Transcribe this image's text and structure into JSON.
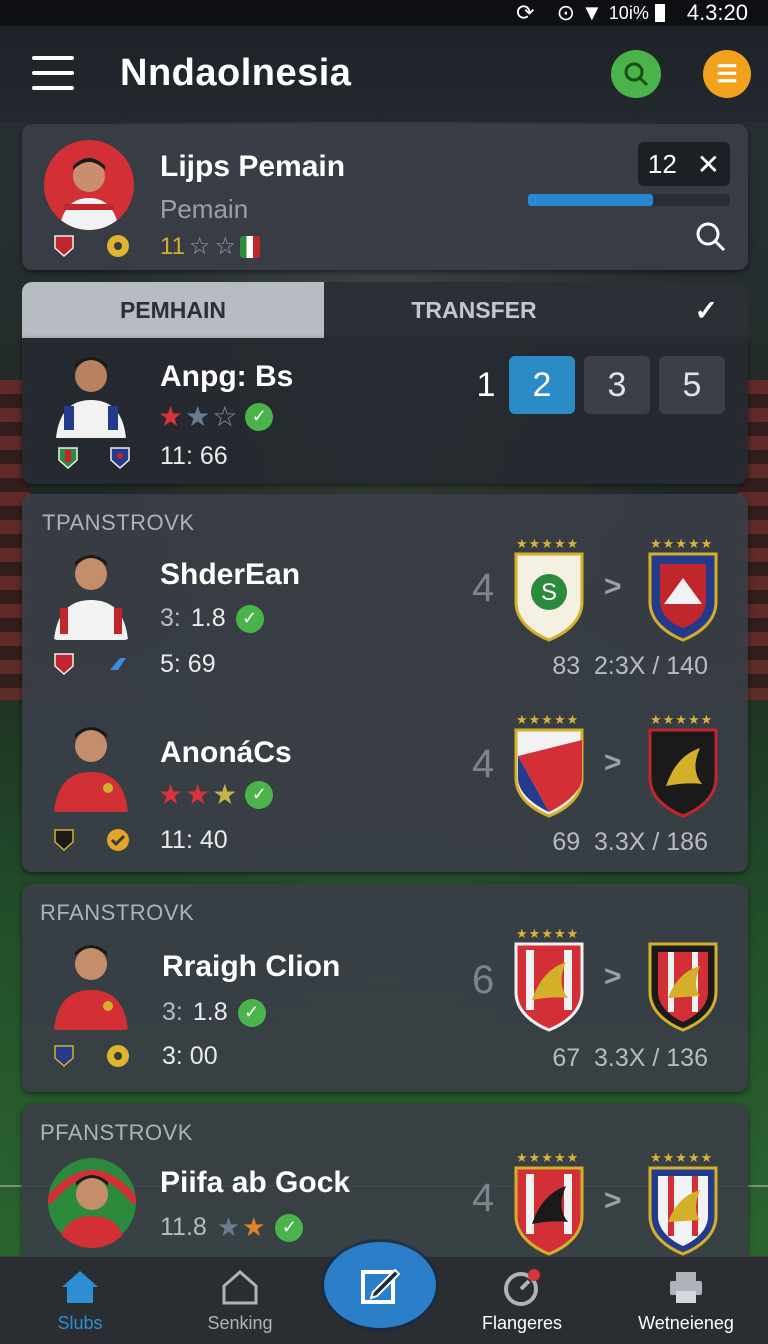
{
  "status_bar": {
    "battery": "10i%",
    "time": "4.3:20"
  },
  "app_bar": {
    "title": "Nndaolnesia"
  },
  "profile": {
    "name": "Lijps Pemain",
    "role": "Pemain",
    "rating": "11",
    "count": "12",
    "progress": 0.62
  },
  "tabs": [
    {
      "label": "PEMHAIN"
    },
    {
      "label": "TRANSFER"
    }
  ],
  "player_row": {
    "name": "Anpg: Bs",
    "time": "11: 66",
    "pages": [
      "1",
      "2",
      "3",
      "5"
    ]
  },
  "sections": [
    {
      "label": "TPANSTROVK",
      "items": [
        {
          "name": "ShderEan",
          "stat_a": "3:",
          "stat_a_val": "1.8",
          "stat_b": "5: 69",
          "count": "4",
          "transfer": "83  2:3X / 140"
        },
        {
          "name": "AnonáCs",
          "stat_b": "11: 40",
          "count": "4",
          "transfer": "69  3.3X / 186"
        }
      ]
    },
    {
      "label": "RFANSTROVK",
      "items": [
        {
          "name": "Rraigh Clion",
          "stat_a": "3:",
          "stat_a_val": "1.8",
          "stat_b": "3: 00",
          "count": "6",
          "transfer": "67  3.3X / 136"
        }
      ]
    },
    {
      "label": "PFANSTROVK",
      "items": [
        {
          "name": "Piifa ab Gock",
          "stat_a": "11.8",
          "count": "4"
        }
      ]
    }
  ],
  "bottom_nav": [
    {
      "label": "Slubs",
      "icon": "home-icon"
    },
    {
      "label": "Senking",
      "icon": "house-outline-icon"
    },
    {
      "label": "Flangeres",
      "icon": "gauge-icon"
    },
    {
      "label": "Wetneieneg",
      "icon": "printer-icon"
    }
  ],
  "colors": {
    "accent": "#2b8bc4",
    "green": "#4ab44a",
    "gold": "#f0a21c",
    "star_red": "#d8323a"
  }
}
